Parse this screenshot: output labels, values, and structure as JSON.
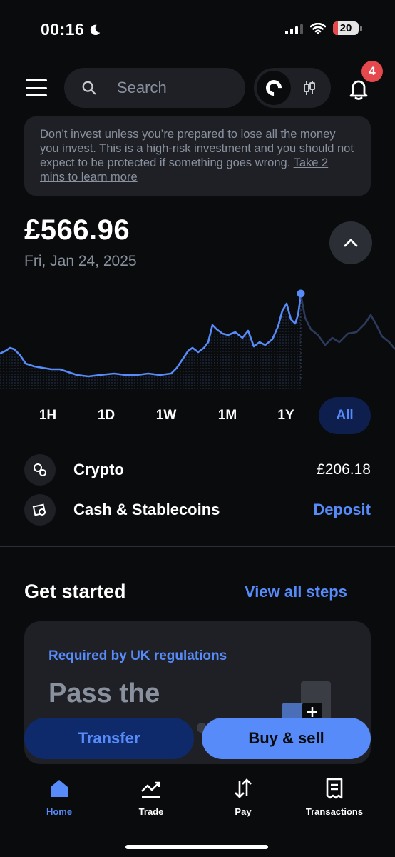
{
  "status_bar": {
    "time": "00:16",
    "battery": "20",
    "battery_level": 0.2
  },
  "header": {
    "search_placeholder": "Search",
    "notification_count": "4"
  },
  "warning": {
    "text": "Don’t invest unless you’re prepared to lose all the money you invest. This is a high-risk investment and you should not expect to be protected if something goes wrong.",
    "link": "Take 2 mins to learn more"
  },
  "balance": {
    "amount": "£566.96",
    "date": "Fri, Jan 24, 2025"
  },
  "ranges": {
    "items": [
      "1H",
      "1D",
      "1W",
      "1M",
      "1Y",
      "All"
    ],
    "selected": "All"
  },
  "assets": {
    "crypto_label": "Crypto",
    "crypto_value": "£206.18",
    "cash_label": "Cash & Stablecoins",
    "deposit_label": "Deposit"
  },
  "get_started": {
    "title": "Get started",
    "view_all": "View all steps",
    "card_tag": "Required by UK regulations",
    "card_heading": "Pass the"
  },
  "actions": {
    "transfer": "Transfer",
    "buy_sell": "Buy & sell"
  },
  "nav": {
    "home": "Home",
    "trade": "Trade",
    "pay": "Pay",
    "transactions": "Transactions",
    "active": "home"
  },
  "colors": {
    "accent": "#578bfa",
    "background": "#0a0b0d",
    "surface": "#1e2025",
    "badge": "#e5484d"
  }
}
